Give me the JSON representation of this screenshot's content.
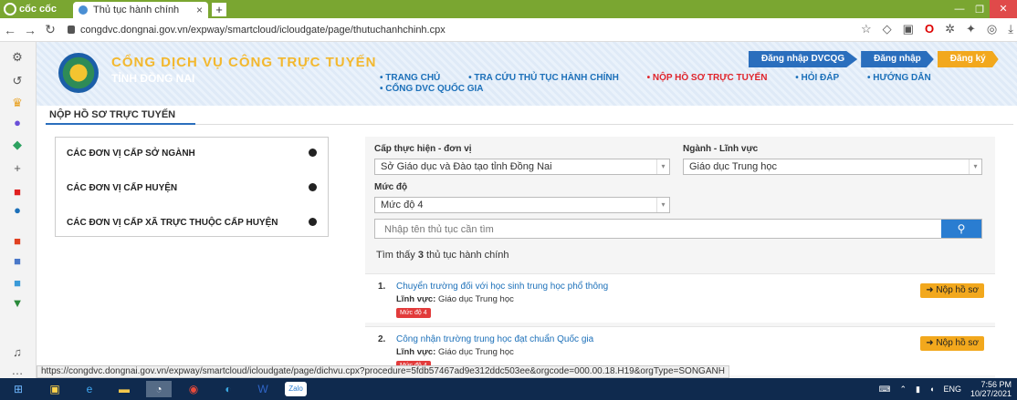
{
  "browser": {
    "brand": "cốc cốc",
    "tab_title": "Thủ tục hành chính",
    "tab_close": "×",
    "new_tab": "+",
    "url": "congdvc.dongnai.gov.vn/expway/smartcloud/icloudgate/page/thutuchanhchinh.cpx"
  },
  "header": {
    "title": "CỔNG DỊCH VỤ CÔNG TRỰC TUYẾN",
    "subtitle": "TỈNH ĐỒNG NAI",
    "buttons": [
      "Đăng nhập DVCQG",
      "Đăng nhập",
      "Đăng ký"
    ],
    "nav": [
      "TRANG CHỦ",
      "TRA CỨU THỦ TỤC HÀNH CHÍNH",
      "NỘP HỒ SƠ TRỰC TUYẾN",
      "HỎI ĐÁP",
      "HƯỚNG DẪN",
      "CỔNG DVC QUỐC GIA"
    ],
    "nav_active_index": 2
  },
  "page": {
    "breadcrumb": "NỘP HỒ SƠ TRỰC TUYẾN",
    "units": [
      "CÁC ĐƠN VỊ CẤP SỞ NGÀNH",
      "CÁC ĐƠN VỊ CẤP HUYỆN",
      "CÁC ĐƠN VỊ CẤP XÃ TRỰC THUỘC CẤP HUYỆN"
    ],
    "filters": {
      "level_label": "Cấp thực hiện - đơn vị",
      "level_value": "Sở Giáo dục và Đào tạo tỉnh Đồng Nai",
      "field_label": "Ngành - Lĩnh vực",
      "field_value": "Giáo dục Trung học",
      "degree_label": "Mức độ",
      "degree_value": "Mức độ 4",
      "search_placeholder": "Nhập tên thủ tục cần tìm"
    },
    "found_prefix": "Tìm thấy ",
    "found_count": "3",
    "found_suffix": " thủ tục hành chính",
    "results": [
      {
        "num": "1.",
        "title": "Chuyển trường đối với học sinh trung học phổ thông",
        "field_label": "Lĩnh vực:",
        "field_value": "Giáo dục Trung học",
        "badge": "Mức độ 4",
        "action": "Nộp hồ sơ"
      },
      {
        "num": "2.",
        "title": "Công nhận trường trung học đạt chuẩn Quốc gia",
        "field_label": "Lĩnh vực:",
        "field_value": "Giáo dục Trung học",
        "badge": "Mức độ 4",
        "action": "Nộp hồ sơ"
      }
    ]
  },
  "status_url": "https://congdvc.dongnai.gov.vn/expway/smartcloud/icloudgate/page/dichvu.cpx?procedure=5fdb57467ad9e312ddc503ee&orgcode=000.00.18.H19&orgType=SONGANH",
  "taskbar": {
    "lang": "ENG",
    "time": "7:56 PM",
    "date": "10/27/2021",
    "zalo": "Zalo"
  }
}
